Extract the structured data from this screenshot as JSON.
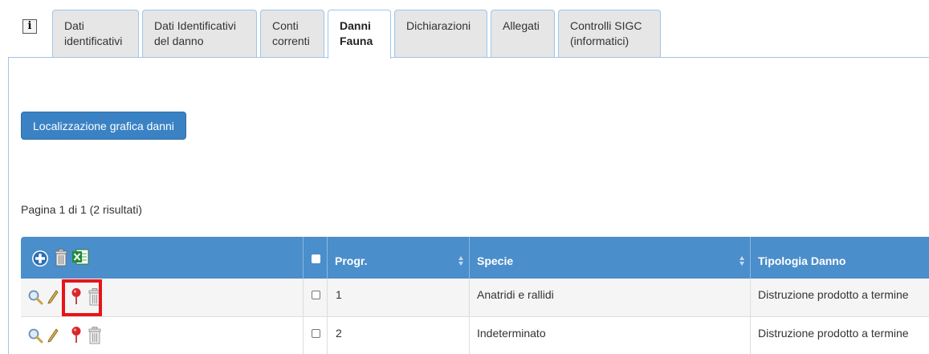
{
  "tabs": [
    {
      "label_line1": "Dati",
      "label_line2": "identificativi",
      "active": false
    },
    {
      "label_line1": "Dati Identificativi",
      "label_line2": "del danno",
      "active": false
    },
    {
      "label_line1": "Conti",
      "label_line2": "correnti",
      "active": false
    },
    {
      "label_line1": "Danni",
      "label_line2": "Fauna",
      "active": true
    },
    {
      "label_line1": "Dichiarazioni",
      "label_line2": "",
      "active": false
    },
    {
      "label_line1": "Allegati",
      "label_line2": "",
      "active": false
    },
    {
      "label_line1": "Controlli SIGC",
      "label_line2": "(informatici)",
      "active": false
    }
  ],
  "info_icon": "info-icon",
  "main": {
    "map_button_label": "Localizzazione grafica danni",
    "pagination_text": "Pagina 1 di 1 (2 risultati)"
  },
  "table": {
    "toolbar_icons": [
      "add-icon",
      "trash-icon",
      "excel-icon"
    ],
    "columns": [
      {
        "key": "select",
        "label": ""
      },
      {
        "key": "progr",
        "label": "Progr."
      },
      {
        "key": "specie",
        "label": "Specie"
      },
      {
        "key": "tipologia",
        "label": "Tipologia Danno"
      }
    ],
    "row_icons": [
      "view-icon",
      "edit-icon",
      "map-pin-icon",
      "trash-icon"
    ],
    "rows": [
      {
        "progr": "1",
        "specie": "Anatridi e rallidi",
        "tipologia": "Distruzione prodotto a termine"
      },
      {
        "progr": "2",
        "specie": "Indeterminato",
        "tipologia": "Distruzione prodotto a termine"
      }
    ]
  },
  "colors": {
    "header_blue": "#4a8ecb",
    "button_blue": "#3a82c4",
    "tab_border": "#9fc5e8",
    "highlight_red": "#e8141a",
    "pin_red": "#d9262c"
  }
}
